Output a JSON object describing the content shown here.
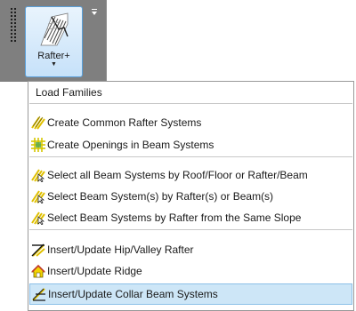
{
  "ribbon": {
    "button_label": "Rafter+"
  },
  "menu": {
    "load_families": "Load Families",
    "create_common_rafter": "Create Common Rafter Systems",
    "create_openings": "Create Openings in Beam Systems",
    "select_all_beam": "Select all Beam Systems by Roof/Floor or Rafter/Beam",
    "select_beam_by_rafter": "Select Beam System(s) by Rafter(s) or Beam(s)",
    "select_beam_same_slope": "Select Beam Systems by Rafter from the Same Slope",
    "insert_hip_valley": "Insert/Update Hip/Valley Rafter",
    "insert_ridge": "Insert/Update Ridge",
    "insert_collar_beam": "Insert/Update Collar Beam Systems"
  },
  "colors": {
    "highlight": "#cde6f7",
    "panel": "#7f7f7f",
    "icon_yellow": "#f2d400"
  }
}
